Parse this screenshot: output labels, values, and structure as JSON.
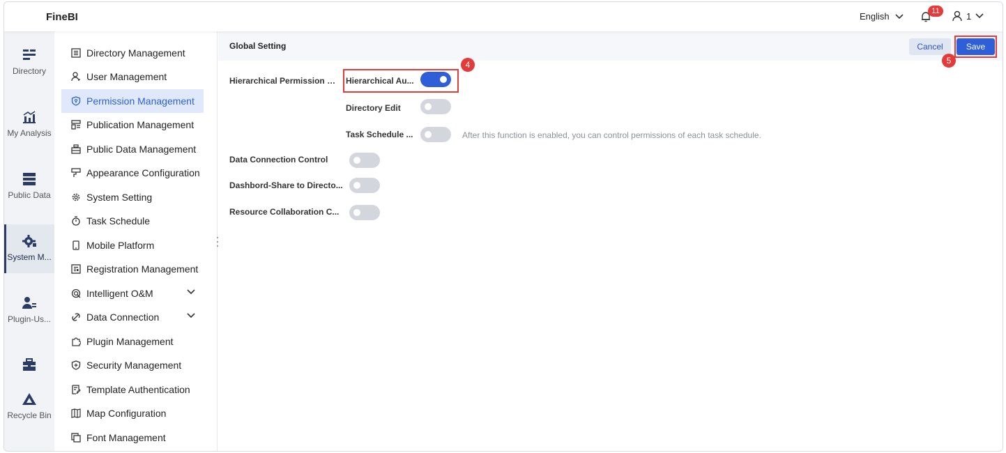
{
  "header": {
    "brand": "FineBI",
    "language": "English",
    "notification_count": "11",
    "user": "1"
  },
  "rail": [
    {
      "label": "Directory",
      "icon": "directory-icon"
    },
    {
      "label": "My Analysis",
      "icon": "my-analysis-icon"
    },
    {
      "label": "Public Data",
      "icon": "public-data-icon"
    },
    {
      "label": "System M...",
      "icon": "system-management-icon",
      "active": true
    },
    {
      "label": "Plugin-Us...",
      "icon": "plugin-user-icon"
    },
    {
      "label": "",
      "icon": "bi-tools-icon"
    },
    {
      "label": "Recycle Bin",
      "icon": "recycle-bin-icon"
    }
  ],
  "menu": [
    {
      "label": "Directory Management",
      "icon": "list-icon"
    },
    {
      "label": "User Management",
      "icon": "user-icon"
    },
    {
      "label": "Permission Management",
      "icon": "shield-icon",
      "active": true
    },
    {
      "label": "Publication Management",
      "icon": "publication-icon"
    },
    {
      "label": "Public Data Management",
      "icon": "database-icon"
    },
    {
      "label": "Appearance Configuration",
      "icon": "brush-icon"
    },
    {
      "label": "System Setting",
      "icon": "gear-icon"
    },
    {
      "label": "Task Schedule",
      "icon": "stopwatch-icon"
    },
    {
      "label": "Mobile Platform",
      "icon": "mobile-icon"
    },
    {
      "label": "Registration Management",
      "icon": "registration-icon"
    },
    {
      "label": "Intelligent O&M",
      "icon": "om-icon",
      "expandable": true
    },
    {
      "label": "Data Connection",
      "icon": "link-icon",
      "expandable": true
    },
    {
      "label": "Plugin Management",
      "icon": "puzzle-icon"
    },
    {
      "label": "Security Management",
      "icon": "shield-plus-icon"
    },
    {
      "label": "Template Authentication",
      "icon": "template-icon"
    },
    {
      "label": "Map Configuration",
      "icon": "map-icon"
    },
    {
      "label": "Font Management",
      "icon": "font-icon"
    }
  ],
  "content": {
    "title": "Global Setting",
    "cancel_label": "Cancel",
    "save_label": "Save",
    "callout_toggle": "4",
    "callout_save": "5",
    "settings": {
      "hierarchical_permission": "Hierarchical Permission M...",
      "hierarchical_auth": "Hierarchical Au...",
      "directory_edit": "Directory Edit",
      "task_schedule": "Task Schedule ...",
      "task_schedule_desc": "After this function is enabled, you can control permissions of each task schedule.",
      "data_connection_control": "Data Connection Control",
      "dashboard_share": "Dashbord-Share to Directo...",
      "resource_collab": "Resource Collaboration C..."
    },
    "toggle_states": {
      "hierarchical_auth": true,
      "directory_edit": false,
      "task_schedule": false,
      "data_connection_control": false,
      "dashboard_share": false,
      "resource_collab": false
    }
  }
}
